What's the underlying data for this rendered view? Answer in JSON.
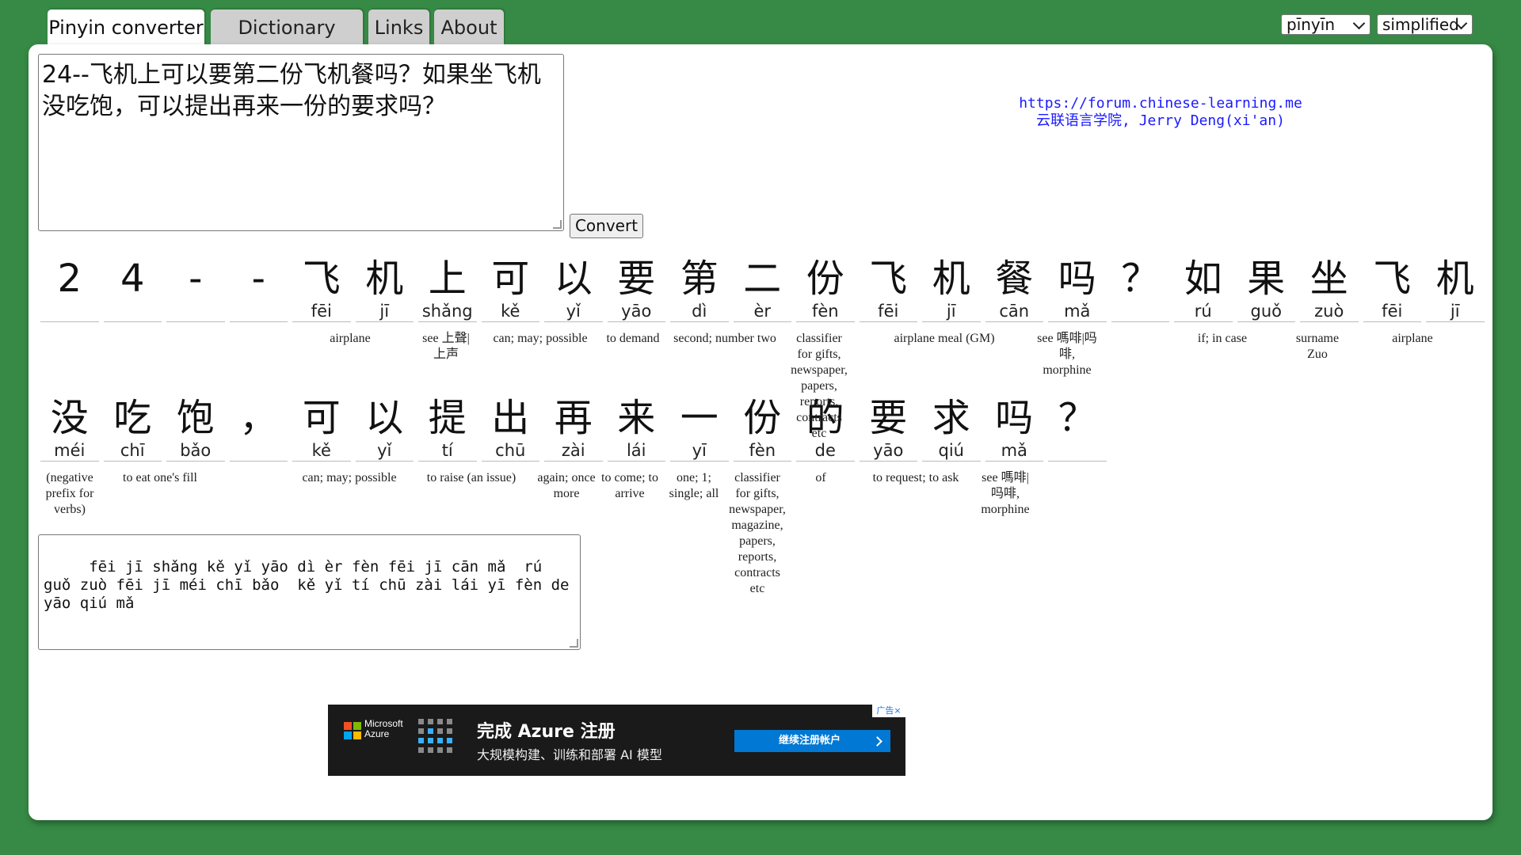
{
  "tabs": [
    "Pinyin converter",
    "Dictionary",
    "Links",
    "About"
  ],
  "selects": {
    "romanization": "pīnyīn",
    "script": "simplified"
  },
  "input_text": "24--飞机上可以要第二份飞机餐吗？如果坐飞机没吃饱，可以提出再来一份的要求吗？",
  "convert_label": "Convert",
  "credit": {
    "url": "https://forum.chinese-learning.me",
    "author": "云联语言学院, Jerry Deng(xi'an)"
  },
  "row1": {
    "chars": [
      {
        "h": "2",
        "p": ""
      },
      {
        "h": "4",
        "p": ""
      },
      {
        "h": "-",
        "p": ""
      },
      {
        "h": "-",
        "p": ""
      },
      {
        "h": "飞",
        "p": "fēi"
      },
      {
        "h": "机",
        "p": "jī"
      },
      {
        "h": "上",
        "p": "shǎng"
      },
      {
        "h": "可",
        "p": "kě"
      },
      {
        "h": "以",
        "p": "yǐ"
      },
      {
        "h": "要",
        "p": "yāo"
      },
      {
        "h": "第",
        "p": "dì"
      },
      {
        "h": "二",
        "p": "èr"
      },
      {
        "h": "份",
        "p": "fèn"
      },
      {
        "h": "飞",
        "p": "fēi"
      },
      {
        "h": "机",
        "p": "jī"
      },
      {
        "h": "餐",
        "p": "cān"
      },
      {
        "h": "吗",
        "p": "mǎ"
      },
      {
        "h": "？",
        "p": ""
      },
      {
        "h": "如",
        "p": "rú"
      },
      {
        "h": "果",
        "p": "guǒ"
      },
      {
        "h": "坐",
        "p": "zuò"
      },
      {
        "h": "飞",
        "p": "fēi"
      },
      {
        "h": "机",
        "p": "jī"
      }
    ],
    "glosses": [
      "airplane",
      "see 上聲|上声",
      "can; may; possible",
      "to demand",
      "second; number two",
      "classifier for gifts, newspaper, papers, reports, contracts etc",
      "airplane meal (GM)",
      "see 嗎啡|吗啡, morphine",
      "if; in case",
      "surname Zuo",
      "airplane"
    ]
  },
  "row2": {
    "chars": [
      {
        "h": "没",
        "p": "méi"
      },
      {
        "h": "吃",
        "p": "chī"
      },
      {
        "h": "饱",
        "p": "bǎo"
      },
      {
        "h": "，",
        "p": ""
      },
      {
        "h": "可",
        "p": "kě"
      },
      {
        "h": "以",
        "p": "yǐ"
      },
      {
        "h": "提",
        "p": "tí"
      },
      {
        "h": "出",
        "p": "chū"
      },
      {
        "h": "再",
        "p": "zài"
      },
      {
        "h": "来",
        "p": "lái"
      },
      {
        "h": "一",
        "p": "yī"
      },
      {
        "h": "份",
        "p": "fèn"
      },
      {
        "h": "的",
        "p": "de"
      },
      {
        "h": "要",
        "p": "yāo"
      },
      {
        "h": "求",
        "p": "qiú"
      },
      {
        "h": "吗",
        "p": "mǎ"
      },
      {
        "h": "？",
        "p": ""
      }
    ],
    "glosses": [
      "(negative prefix for verbs)",
      "to eat one's fill",
      "can; may; possible",
      "to raise (an issue)",
      "again; once more",
      "to come; to arrive",
      "one; 1; single; all",
      "classifier for gifts, newspaper, magazine, papers, reports, contracts etc",
      "of",
      "to request; to ask",
      "see 嗎啡|吗啡, morphine"
    ]
  },
  "output_text": "   fēi jī shǎng kě yǐ yāo dì èr fèn fēi jī cān mǎ  rú guǒ zuò fēi jī méi chī bǎo  kě yǐ tí chū zài lái yī fèn de yāo qiú mǎ",
  "ad": {
    "brand_line1": "Microsoft",
    "brand_line2": "Azure",
    "headline": "完成 Azure 注册",
    "subline": "大规模构建、训练和部署 AI 模型",
    "cta": "继续注册帐户",
    "adchoice": "广告×",
    "colors": {
      "red": "#f25022",
      "green": "#7fba00",
      "blue": "#00a4ef",
      "yellow": "#ffb900",
      "cta": "#0078d4"
    }
  }
}
